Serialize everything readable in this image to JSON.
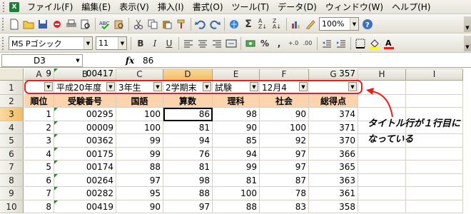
{
  "menu": [
    "ファイル(F)",
    "編集(E)",
    "表示(V)",
    "挿入(I)",
    "書式(O)",
    "ツール(T)",
    "データ(D)",
    "ウィンドウ(W)",
    "ヘルプ(H)"
  ],
  "app_icon": "X",
  "toolbar": {
    "zoom": "100%",
    "icons": [
      "new-icon",
      "open-icon",
      "save-icon",
      "permission-icon",
      "print-icon",
      "print-preview-icon",
      "spelling-icon",
      "research-icon",
      "cut-icon",
      "copy-icon",
      "paste-icon",
      "format-painter-icon",
      "undo-icon",
      "redo-icon",
      "hyperlink-icon",
      "autosum-icon",
      "sort-asc-icon",
      "sort-desc-icon",
      "chart-icon",
      "drawing-icon",
      "help-icon"
    ]
  },
  "format_toolbar": {
    "font": "MS Pゴシック",
    "size": "11",
    "bold": "B",
    "italic": "I",
    "underline": "U",
    "percent": "%",
    "comma": ","
  },
  "formula_bar": {
    "name_box": "D3",
    "fx": "fx",
    "value": "86"
  },
  "columns": [
    "A",
    "B",
    "C",
    "D",
    "E",
    "F",
    "G",
    "H",
    "I"
  ],
  "rows": [
    "1",
    "2",
    "3",
    "4",
    "5",
    "6",
    "7",
    "8",
    "9",
    "10"
  ],
  "filter_row": [
    "",
    "平成20年度",
    "3年生",
    "2学期末",
    "試験",
    "12月4",
    ""
  ],
  "headers": [
    "順位",
    "受験番号",
    "国語",
    "算数",
    "理科",
    "社会",
    "総得点"
  ],
  "data_rows": [
    [
      "1",
      "00295",
      "100",
      "86",
      "98",
      "90",
      "374"
    ],
    [
      "2",
      "00009",
      "100",
      "81",
      "90",
      "100",
      "371"
    ],
    [
      "3",
      "00362",
      "99",
      "94",
      "85",
      "92",
      "370"
    ],
    [
      "4",
      "00175",
      "99",
      "76",
      "94",
      "97",
      "366"
    ],
    [
      "5",
      "00174",
      "88",
      "81",
      "99",
      "97",
      "365"
    ],
    [
      "6",
      "00264",
      "97",
      "98",
      "81",
      "87",
      "363"
    ],
    [
      "7",
      "00282",
      "95",
      "88",
      "100",
      "78",
      "361"
    ],
    [
      "8",
      "00419",
      "90",
      "97",
      "88",
      "83",
      "358"
    ],
    [
      "9",
      "00417",
      "",
      "",
      "",
      "",
      "357"
    ]
  ],
  "annotation": {
    "line1": "タイトル行が１行目に",
    "line2": "なっている",
    "color": "#e8201a"
  }
}
